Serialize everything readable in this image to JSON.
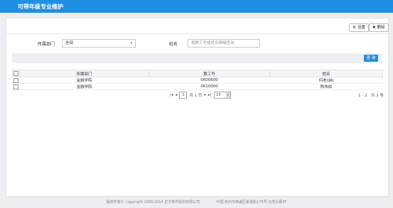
{
  "header": {
    "title": "可带年级专业维护"
  },
  "toolbar": {
    "settings_label": "设置",
    "delete_label": "删除",
    "settings_icon": "gear-icon",
    "delete_icon": "close-icon"
  },
  "filters": {
    "dept_label": "所属部门",
    "dept_value": "全部",
    "name_label": "姓名",
    "name_placeholder": "按教工号或姓名模糊查询"
  },
  "query": {
    "label": "查 询",
    "color": "#2b8bd6"
  },
  "table": {
    "columns": [
      "所属部门",
      "教工号",
      "姓名"
    ],
    "rows": [
      {
        "dept": "金融学院",
        "id": "0600600",
        "name": "何老(昶)"
      },
      {
        "dept": "金融学院",
        "id": "0610000",
        "name": "陈伟伯"
      }
    ]
  },
  "pager": {
    "current": "1",
    "total_pages": "共 1 页",
    "page_size": "15",
    "summary": "1 - 2　共 2 条"
  },
  "footer": {
    "copyright": "版权所有© Copyright 1999-2014 正方软件股份有限公司",
    "address": "中国·杭州市西湖区紫霞街176号 元茂大厦3F"
  },
  "colors": {
    "topbar": "#1f8fe4",
    "background": "#eceef1"
  }
}
